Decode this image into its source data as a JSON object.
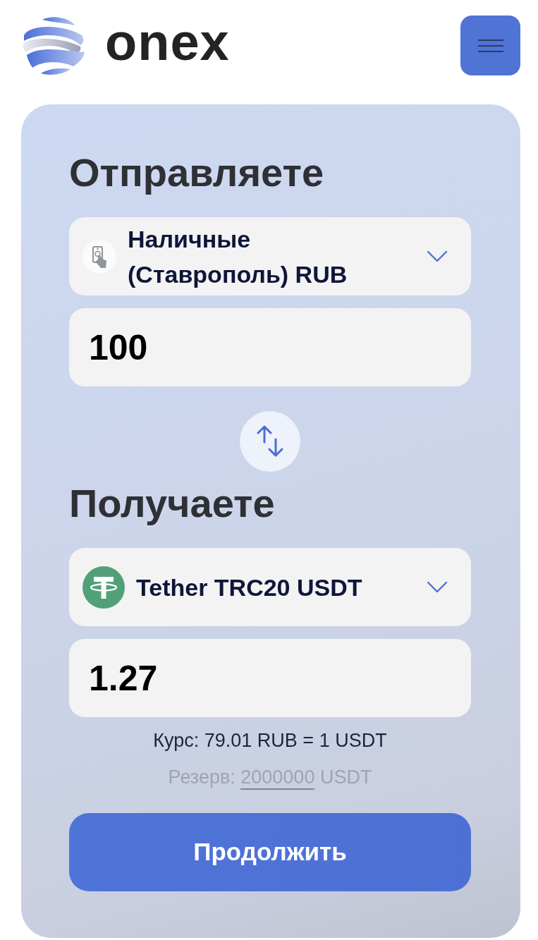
{
  "header": {
    "logo_text": "onex"
  },
  "send": {
    "heading": "Отправляете",
    "currency": {
      "kind": "cash",
      "name": "Наличные (Ставрополь) RUB"
    },
    "amount": "100"
  },
  "receive": {
    "heading": "Получаете",
    "currency": {
      "kind": "crypto",
      "name": "Tether TRC20 USDT"
    },
    "amount": "1.27"
  },
  "rate": "Курс: 79.01 RUB = 1 USDT",
  "reserve": {
    "label": "Резерв:",
    "amount": "2000000",
    "unit": "USDT"
  },
  "submit_button": "Продолжить"
}
